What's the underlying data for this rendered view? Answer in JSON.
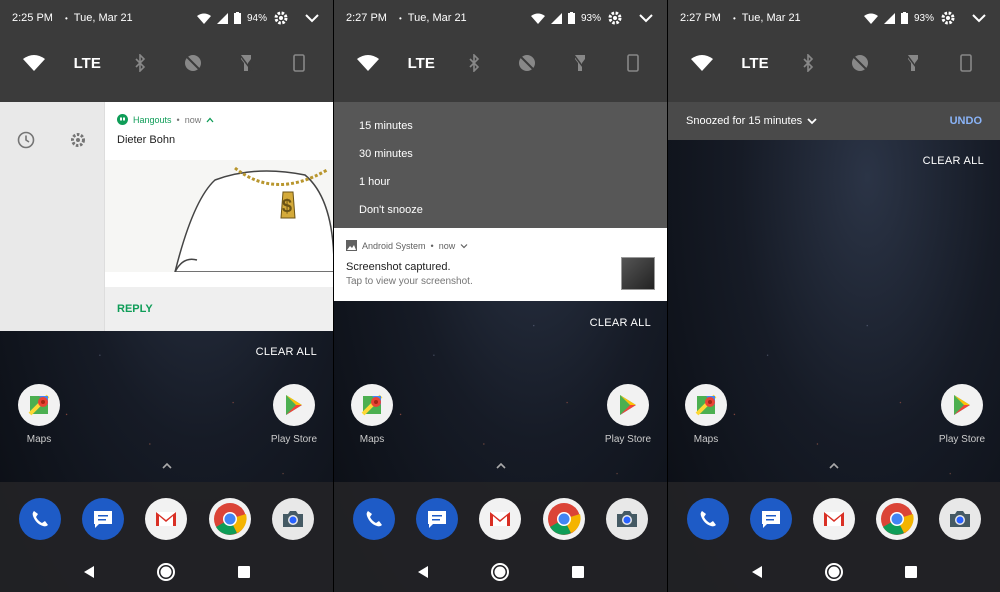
{
  "screens": [
    {
      "status": {
        "time": "2:25 PM",
        "date": "Tue, Mar 21",
        "battery": "94%"
      },
      "quick_settings": {
        "lte_label": "LTE"
      },
      "notification": {
        "app_name": "Hangouts",
        "when": "now",
        "title": "Dieter Bohn",
        "action": "REPLY"
      },
      "clear_all": "CLEAR ALL",
      "home": {
        "left_app": "Maps",
        "right_app": "Play Store"
      }
    },
    {
      "status": {
        "time": "2:27 PM",
        "date": "Tue, Mar 21",
        "battery": "93%"
      },
      "quick_settings": {
        "lte_label": "LTE"
      },
      "snooze_options": [
        "15 minutes",
        "30 minutes",
        "1 hour",
        "Don't snooze"
      ],
      "notification": {
        "app_name": "Android System",
        "when": "now",
        "title": "Screenshot captured.",
        "text": "Tap to view your screenshot."
      },
      "clear_all": "CLEAR ALL",
      "home": {
        "left_app": "Maps",
        "right_app": "Play Store"
      }
    },
    {
      "status": {
        "time": "2:27 PM",
        "date": "Tue, Mar 21",
        "battery": "93%"
      },
      "quick_settings": {
        "lte_label": "LTE"
      },
      "snoozed": {
        "text": "Snoozed for 15 minutes",
        "undo": "UNDO"
      },
      "clear_all": "CLEAR ALL",
      "home": {
        "left_app": "Maps",
        "right_app": "Play Store"
      }
    }
  ],
  "colors": {
    "hangouts_green": "#0f9d58",
    "undo_blue": "#8ab4f8",
    "shade": "#3b3b3b"
  },
  "icons": [
    "wifi-icon",
    "signal-icon",
    "battery-icon",
    "gear-icon",
    "chevron-down-icon",
    "bluetooth-off-icon",
    "dnd-off-icon",
    "flashlight-off-icon",
    "rotation-icon",
    "clock-icon"
  ]
}
